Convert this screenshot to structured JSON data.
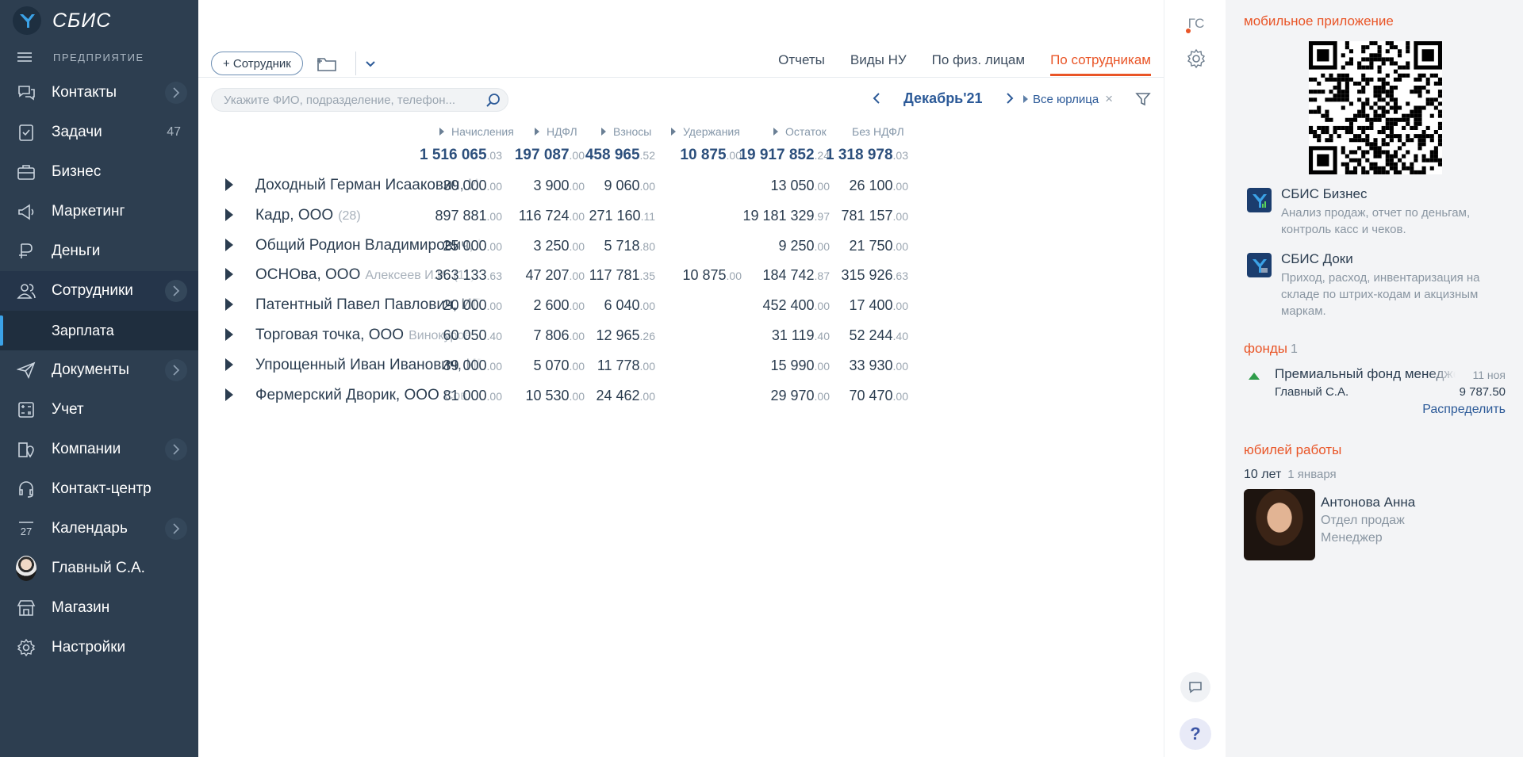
{
  "brand": {
    "name": "СБИС",
    "org": "ПРЕДПРИЯТИЕ"
  },
  "nav": [
    {
      "label": "Контакты",
      "icon": "chat-bubbles-icon",
      "chevron": true
    },
    {
      "label": "Задачи",
      "icon": "tasks-icon",
      "count": "47"
    },
    {
      "label": "Бизнес",
      "icon": "briefcase-icon"
    },
    {
      "label": "Маркетинг",
      "icon": "megaphone-icon"
    },
    {
      "label": "Деньги",
      "icon": "money-icon"
    },
    {
      "label": "Сотрудники",
      "icon": "people-icon",
      "chevron": true,
      "active": true
    },
    {
      "label": "Документы",
      "icon": "paper-plane-icon",
      "chevron": true
    },
    {
      "label": "Учет",
      "icon": "calculator-icon"
    },
    {
      "label": "Компании",
      "icon": "company-pin-icon",
      "chevron": true
    },
    {
      "label": "Контакт-центр",
      "icon": "headset-icon"
    },
    {
      "label": "Календарь",
      "icon": "calendar-icon",
      "chevron": true,
      "iconText": "27"
    },
    {
      "label": "Главный С.А.",
      "icon": "user-avatar"
    },
    {
      "label": "Магазин",
      "icon": "store-icon"
    },
    {
      "label": "Настройки",
      "icon": "gear-icon"
    }
  ],
  "nav_sub": {
    "label": "Зарплата"
  },
  "toolbar": {
    "add_label": "+ Сотрудник"
  },
  "tabs": [
    {
      "label": "Отчеты"
    },
    {
      "label": "Виды НУ"
    },
    {
      "label": "По физ. лицам"
    },
    {
      "label": "По сотрудникам",
      "active": true
    }
  ],
  "search": {
    "placeholder": "Укажите ФИО, подразделение, телефон..."
  },
  "period": {
    "label": "Декабрь'21"
  },
  "legal": {
    "label": "Все юрлица"
  },
  "table": {
    "columns": [
      {
        "label": "Начисления",
        "total_int": "1 516 065",
        "total_dec": ".03"
      },
      {
        "label": "НДФЛ",
        "total_int": "197 087",
        "total_dec": ".00"
      },
      {
        "label": "Взносы",
        "total_int": "458 965",
        "total_dec": ".52"
      },
      {
        "label": "Удержания",
        "total_int": "10 875",
        "total_dec": ".00"
      },
      {
        "label": "Остаток",
        "total_int": "19 917 852",
        "total_dec": ".24"
      },
      {
        "label": "Без НДФЛ",
        "total_int": "1 318 978",
        "total_dec": ".03"
      }
    ],
    "rows": [
      {
        "name": "Доходный Герман Исаакович, ИП",
        "sub": "",
        "cells": [
          [
            "30 000",
            ".00"
          ],
          [
            "3 900",
            ".00"
          ],
          [
            "9 060",
            ".00"
          ],
          null,
          [
            "13 050",
            ".00"
          ],
          [
            "26 100",
            ".00"
          ]
        ]
      },
      {
        "name": "Кадр, ООО",
        "sub": "(28)",
        "cells": [
          [
            "897 881",
            ".00"
          ],
          [
            "116 724",
            ".00"
          ],
          [
            "271 160",
            ".11"
          ],
          null,
          [
            "19 181 329",
            ".97"
          ],
          [
            "781 157",
            ".00"
          ]
        ]
      },
      {
        "name": "Общий Родион Владимирович, ИП",
        "sub": "",
        "cells": [
          [
            "25 000",
            ".00"
          ],
          [
            "3 250",
            ".00"
          ],
          [
            "5 718",
            ".80"
          ],
          null,
          [
            "9 250",
            ".00"
          ],
          [
            "21 750",
            ".00"
          ]
        ]
      },
      {
        "name": "ОСНОва, ООО",
        "sub": "Алексеев И.И. (11)",
        "cells": [
          [
            "363 133",
            ".63"
          ],
          [
            "47 207",
            ".00"
          ],
          [
            "117 781",
            ".35"
          ],
          [
            "10 875",
            ".00"
          ],
          [
            "184 742",
            ".87"
          ],
          [
            "315 926",
            ".63"
          ]
        ]
      },
      {
        "name": "Патентный Павел Павлович, ИП",
        "sub": "",
        "cells": [
          [
            "20 000",
            ".00"
          ],
          [
            "2 600",
            ".00"
          ],
          [
            "6 040",
            ".00"
          ],
          null,
          [
            "452 400",
            ".00"
          ],
          [
            "17 400",
            ".00"
          ]
        ]
      },
      {
        "name": "Торговая точка, ООО",
        "sub": "Винокуров",
        "cells": [
          [
            "60 050",
            ".40"
          ],
          [
            "7 806",
            ".00"
          ],
          [
            "12 965",
            ".26"
          ],
          null,
          [
            "31 119",
            ".40"
          ],
          [
            "52 244",
            ".40"
          ]
        ]
      },
      {
        "name": "Упрощенный Иван Иванович, ИП",
        "sub": "",
        "cells": [
          [
            "39 000",
            ".00"
          ],
          [
            "5 070",
            ".00"
          ],
          [
            "11 778",
            ".00"
          ],
          null,
          [
            "15 990",
            ".00"
          ],
          [
            "33 930",
            ".00"
          ]
        ]
      },
      {
        "name": "Фермерский Дворик, ООО",
        "sub": "Сов",
        "cells": [
          [
            "81 000",
            ".00"
          ],
          [
            "10 530",
            ".00"
          ],
          [
            "24 462",
            ".00"
          ],
          null,
          [
            "29 970",
            ".00"
          ],
          [
            "70 470",
            ".00"
          ]
        ]
      }
    ]
  },
  "rail": {
    "initials": "ГС"
  },
  "panel": {
    "mobile_title": "мобильное приложение",
    "apps": [
      {
        "title": "СБИС Бизнес",
        "desc": "Анализ продаж, отчет по деньгам, контроль касс и чеков."
      },
      {
        "title": "СБИС Доки",
        "desc": "Приход, расход, инвентаризация на складе по штрих-кодам и акцизным маркам."
      }
    ],
    "funds_title": "фонды",
    "funds_count": "1",
    "fund": {
      "title": "Премиальный фонд менеджеров",
      "date": "11 ноя",
      "who": "Главный С.А.",
      "amount": "9 787.50",
      "action": "Распределить"
    },
    "jubilee_title": "юбилей работы",
    "jubilee": {
      "years": "10 лет",
      "date": "1 января",
      "name": "Антонова Анна",
      "dept": "Отдел продаж",
      "role": "Менеджер"
    }
  },
  "colors": {
    "sidebar": "#2d3e50",
    "accent": "#e95527",
    "link": "#2c5a98"
  }
}
